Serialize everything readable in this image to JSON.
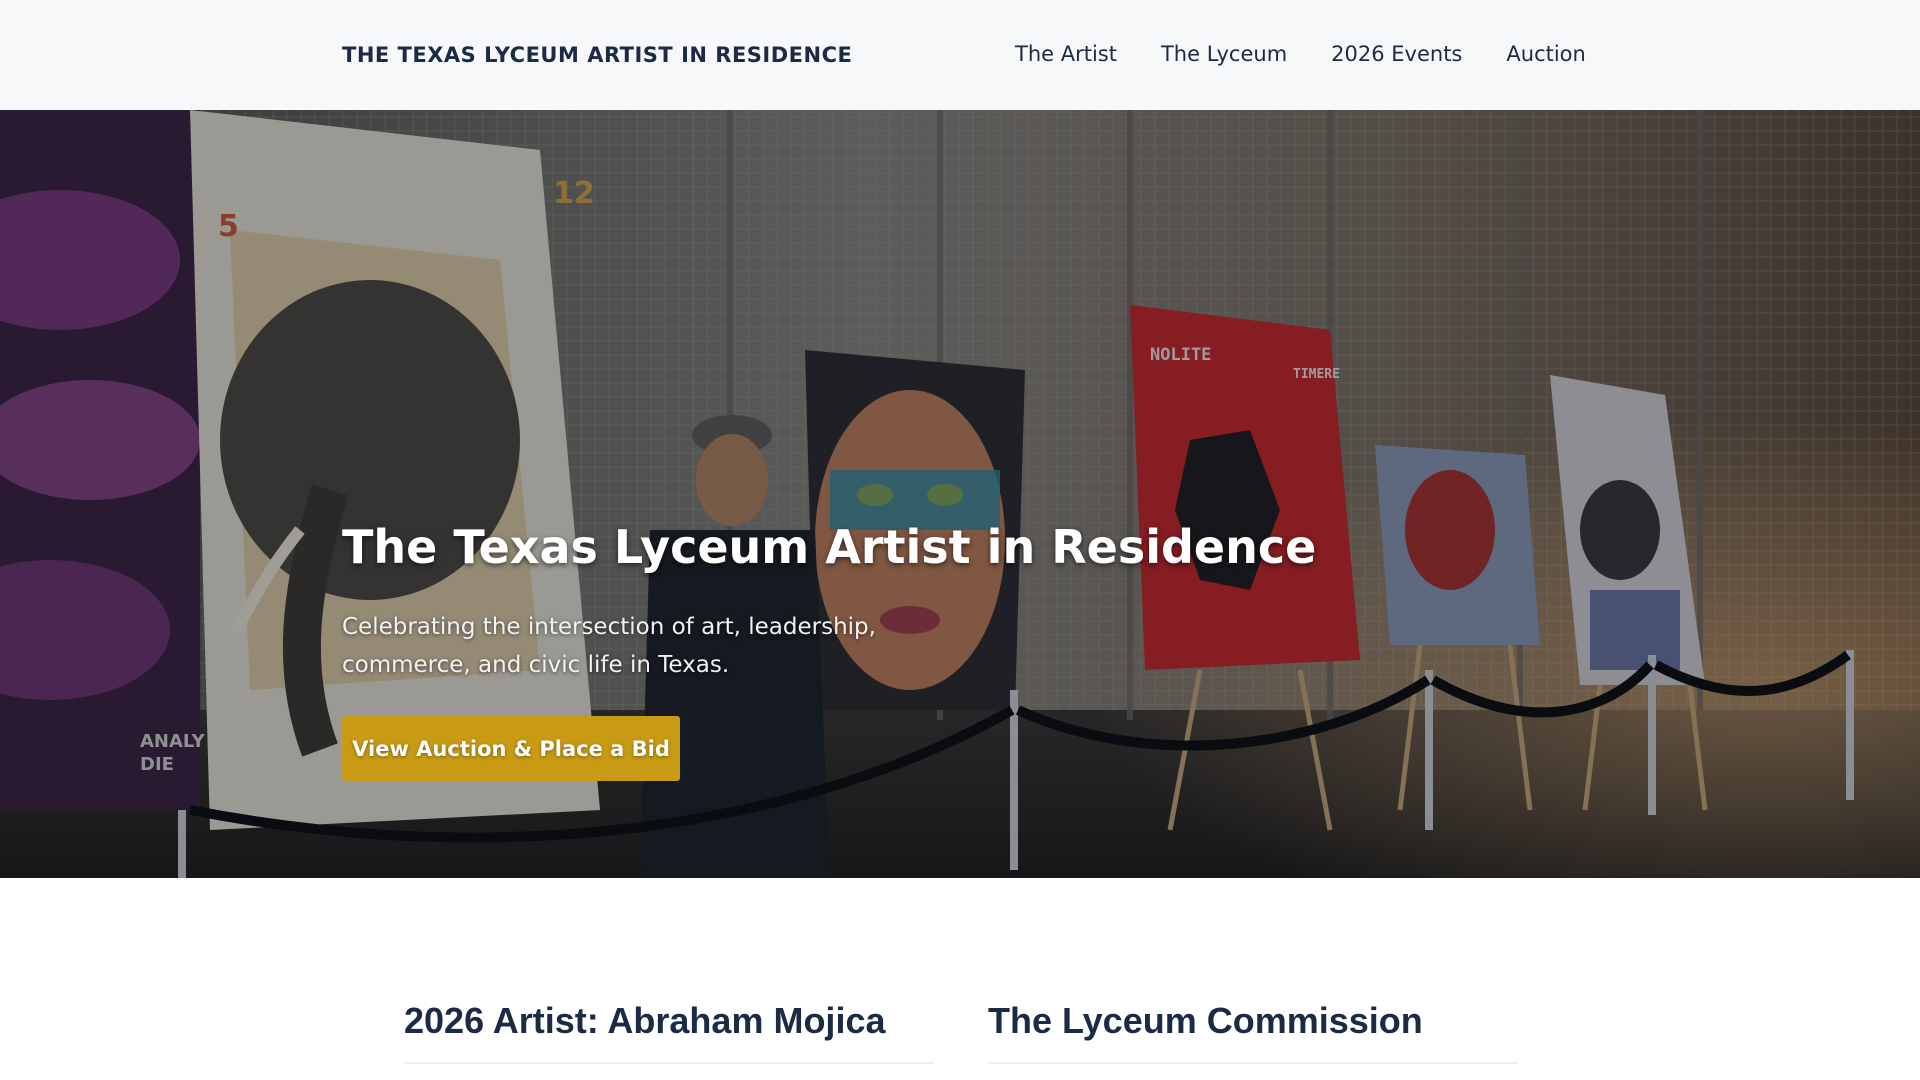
{
  "header": {
    "brand": "THE TEXAS LYCEUM ARTIST IN RESIDENCE",
    "nav": [
      {
        "label": "The Artist"
      },
      {
        "label": "The Lyceum"
      },
      {
        "label": "2026 Events"
      },
      {
        "label": "Auction"
      }
    ]
  },
  "hero": {
    "title": "The Texas Lyceum Artist in Residence",
    "subtitle": "Celebrating the intersection of art, leadership, commerce, and civic life in Texas.",
    "cta_label": "View Auction & Place a Bid",
    "image_description": "Artist standing among painted canvases on easels in a gallery hall",
    "painting_texts": [
      "5",
      "12",
      "NOLITE",
      "TIMERE",
      "ANALY",
      "DIE"
    ]
  },
  "sections": [
    {
      "title": "2026 Artist: Abraham Mojica"
    },
    {
      "title": "The Lyceum Commission"
    }
  ],
  "colors": {
    "header_bg": "#f7f8fa",
    "navy": "#1b2a45",
    "accent_gold": "#c99a14"
  }
}
